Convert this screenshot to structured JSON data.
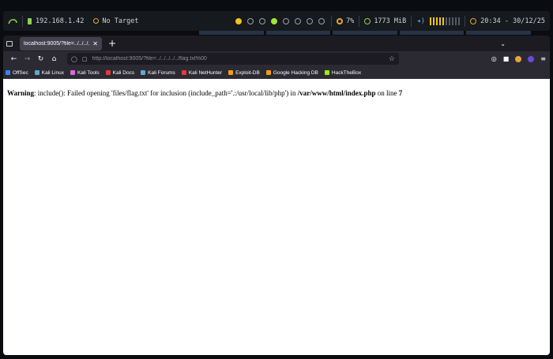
{
  "topbar": {
    "ip": "192.168.1.42",
    "target": "No Target",
    "cpu": "7%",
    "memory": "1773 MiB",
    "volume_level": 0.5,
    "clock": "20:34 - 30/12/25"
  },
  "browser": {
    "tab_title": "localhost:9005/?file=../../../../..",
    "url": "http://localhost:9005/?file=../../../../../flag.txt%00",
    "bookmarks": [
      {
        "label": "OffSec",
        "color": "#3b82f6"
      },
      {
        "label": "Kali Linux",
        "color": "#5fa8d3"
      },
      {
        "label": "Kali Tools",
        "color": "#d96ad8"
      },
      {
        "label": "Kali Docs",
        "color": "#e23b3b"
      },
      {
        "label": "Kali Forums",
        "color": "#5fa8d3"
      },
      {
        "label": "Kali NetHunter",
        "color": "#e23b3b"
      },
      {
        "label": "Exploit-DB",
        "color": "#f59e0b"
      },
      {
        "label": "Google Hacking DB",
        "color": "#f59e0b"
      },
      {
        "label": "HackTheBox",
        "color": "#9fef00"
      }
    ]
  },
  "page": {
    "warning_label": "Warning",
    "message": ": include(): Failed opening 'files/flag.txt' for inclusion (include_path='.:/usr/local/lib/php') in ",
    "file": "/var/www/html/index.php",
    "on_line": " on line ",
    "line": "7"
  }
}
